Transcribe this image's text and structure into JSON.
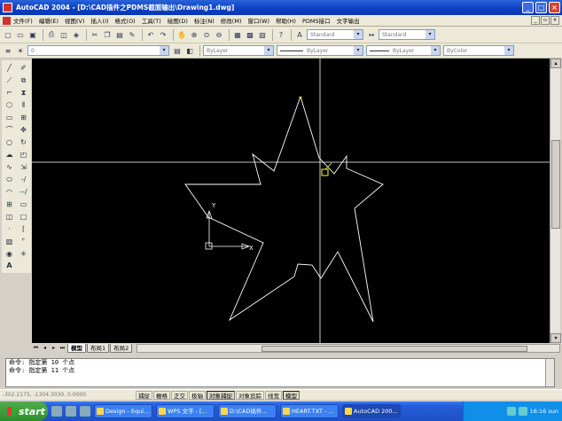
{
  "window": {
    "title": "AutoCAD 2004 - [D:\\CAD插件之PDMS截面输出\\Drawing1.dwg]",
    "minimize": "_",
    "restore": "□",
    "close": "×"
  },
  "menu": [
    "文件(F)",
    "编辑(E)",
    "视图(V)",
    "插入(I)",
    "格式(O)",
    "工具(T)",
    "绘图(D)",
    "标注(N)",
    "修改(M)",
    "窗口(W)",
    "帮助(H)",
    "PDMS接口",
    "文字输出"
  ],
  "toolbar1": {
    "text_style": "Standard",
    "dim_style": "Standard"
  },
  "toolbar2": {
    "layer": "0",
    "color": "ByLayer",
    "linetype": "ByLayer",
    "lineweight": "ByLayer",
    "plotstyle": "ByColor"
  },
  "tabs": [
    "模型",
    "布局1",
    "布局2"
  ],
  "command": {
    "lines": [
      "命令: 指定第 10 个点",
      "命令: 指定第 11 个点"
    ]
  },
  "status": {
    "coords": "-302.2175, -1304.3030, 0.0000",
    "buttons": [
      "捕捉",
      "栅格",
      "正交",
      "极轴",
      "对象捕捉",
      "对象追踪",
      "线宽",
      "模型"
    ],
    "on": [
      false,
      false,
      false,
      false,
      true,
      false,
      false,
      true
    ]
  },
  "taskbar": {
    "start": "start",
    "tasks": [
      "Design - Equi...",
      "WPS 文字 - [...",
      "D:\\CAD插件...",
      "HEART.TXT - ...",
      "AutoCAD 200..."
    ],
    "active_index": 4,
    "clock": "16:16 sun"
  },
  "drawing": {
    "ucs_x": "X",
    "ucs_y": "Y",
    "background": "#000000",
    "line_color": "#ffffff",
    "snap_color": "#ffff00"
  }
}
